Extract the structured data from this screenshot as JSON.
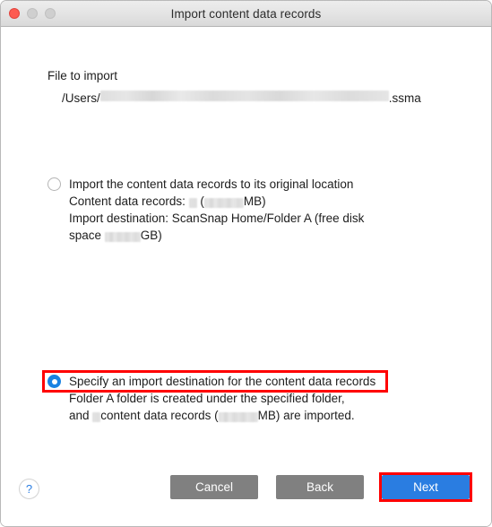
{
  "window": {
    "title": "Import content data records",
    "traffic_lights": [
      "close",
      "minimize",
      "zoom"
    ]
  },
  "file_section": {
    "label": "File to import",
    "path_prefix": "/Users/",
    "path_redacted": true,
    "path_suffix": ".ssma"
  },
  "options": [
    {
      "id": "original-location",
      "selected": false,
      "title": "Import the content data records to its original location",
      "detail_line1_prefix": "Content data records: ",
      "detail_line1_mid": " (",
      "detail_line1_suffix": "MB)",
      "detail_line2_prefix": "Import destination: ScanSnap Home/Folder A (free disk",
      "detail_line3_prefix": "space ",
      "detail_line3_suffix": "GB)"
    },
    {
      "id": "specify-destination",
      "selected": true,
      "title": "Specify an import destination for the content data records",
      "detail_line1": "Folder A folder is created under the specified folder,",
      "detail_line2_prefix": "and ",
      "detail_line2_mid": "content data records (",
      "detail_line2_suffix": "MB) are imported."
    }
  ],
  "footer": {
    "help_label": "?",
    "cancel_label": "Cancel",
    "back_label": "Back",
    "next_label": "Next"
  },
  "colors": {
    "accent_blue": "#2a7de1",
    "radio_blue": "#1a82e2",
    "highlight_red": "#ff0000",
    "button_gray": "#808080"
  }
}
